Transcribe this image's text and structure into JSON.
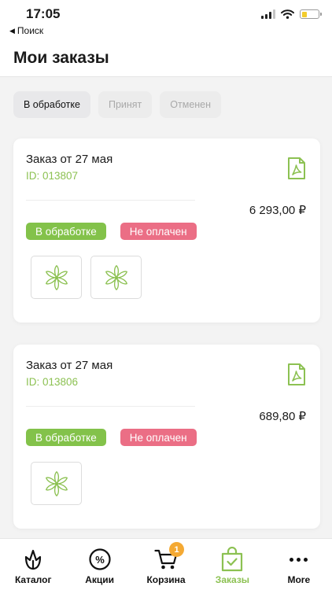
{
  "status_bar": {
    "time": "17:05",
    "back_label": "Поиск",
    "battery_level": 0.3,
    "battery_color": "#f2cc2d"
  },
  "page": {
    "title": "Мои заказы"
  },
  "filters": [
    {
      "label": "В обработке",
      "active": true
    },
    {
      "label": "Принят",
      "active": false
    },
    {
      "label": "Отменен",
      "active": false
    }
  ],
  "orders": [
    {
      "title": "Заказ от 27 мая",
      "id_label": "ID: 013807",
      "total": "6 293,00 ₽",
      "status_badge": "В обработке",
      "payment_badge": "Не оплачен",
      "item_count": 2
    },
    {
      "title": "Заказ от 27 мая",
      "id_label": "ID: 013806",
      "total": "689,80 ₽",
      "status_badge": "В обработке",
      "payment_badge": "Не оплачен",
      "item_count": 1
    }
  ],
  "icons": {
    "document": "pdf-document-icon",
    "product": "flower-logo-icon"
  },
  "colors": {
    "accent_green": "#8cc152",
    "status_green": "#83c24a",
    "status_red": "#eb6e85",
    "cart_badge": "#f4a933"
  },
  "tabbar": {
    "catalog": {
      "label": "Каталог",
      "icon": "tulip-icon"
    },
    "promotions": {
      "label": "Акции",
      "icon": "percent-icon"
    },
    "cart": {
      "label": "Корзина",
      "icon": "cart-icon",
      "badge": "1"
    },
    "orders": {
      "label": "Заказы",
      "icon": "shopping-bag-icon",
      "active": true
    },
    "more": {
      "label": "More",
      "icon": "more-dots-icon"
    }
  }
}
